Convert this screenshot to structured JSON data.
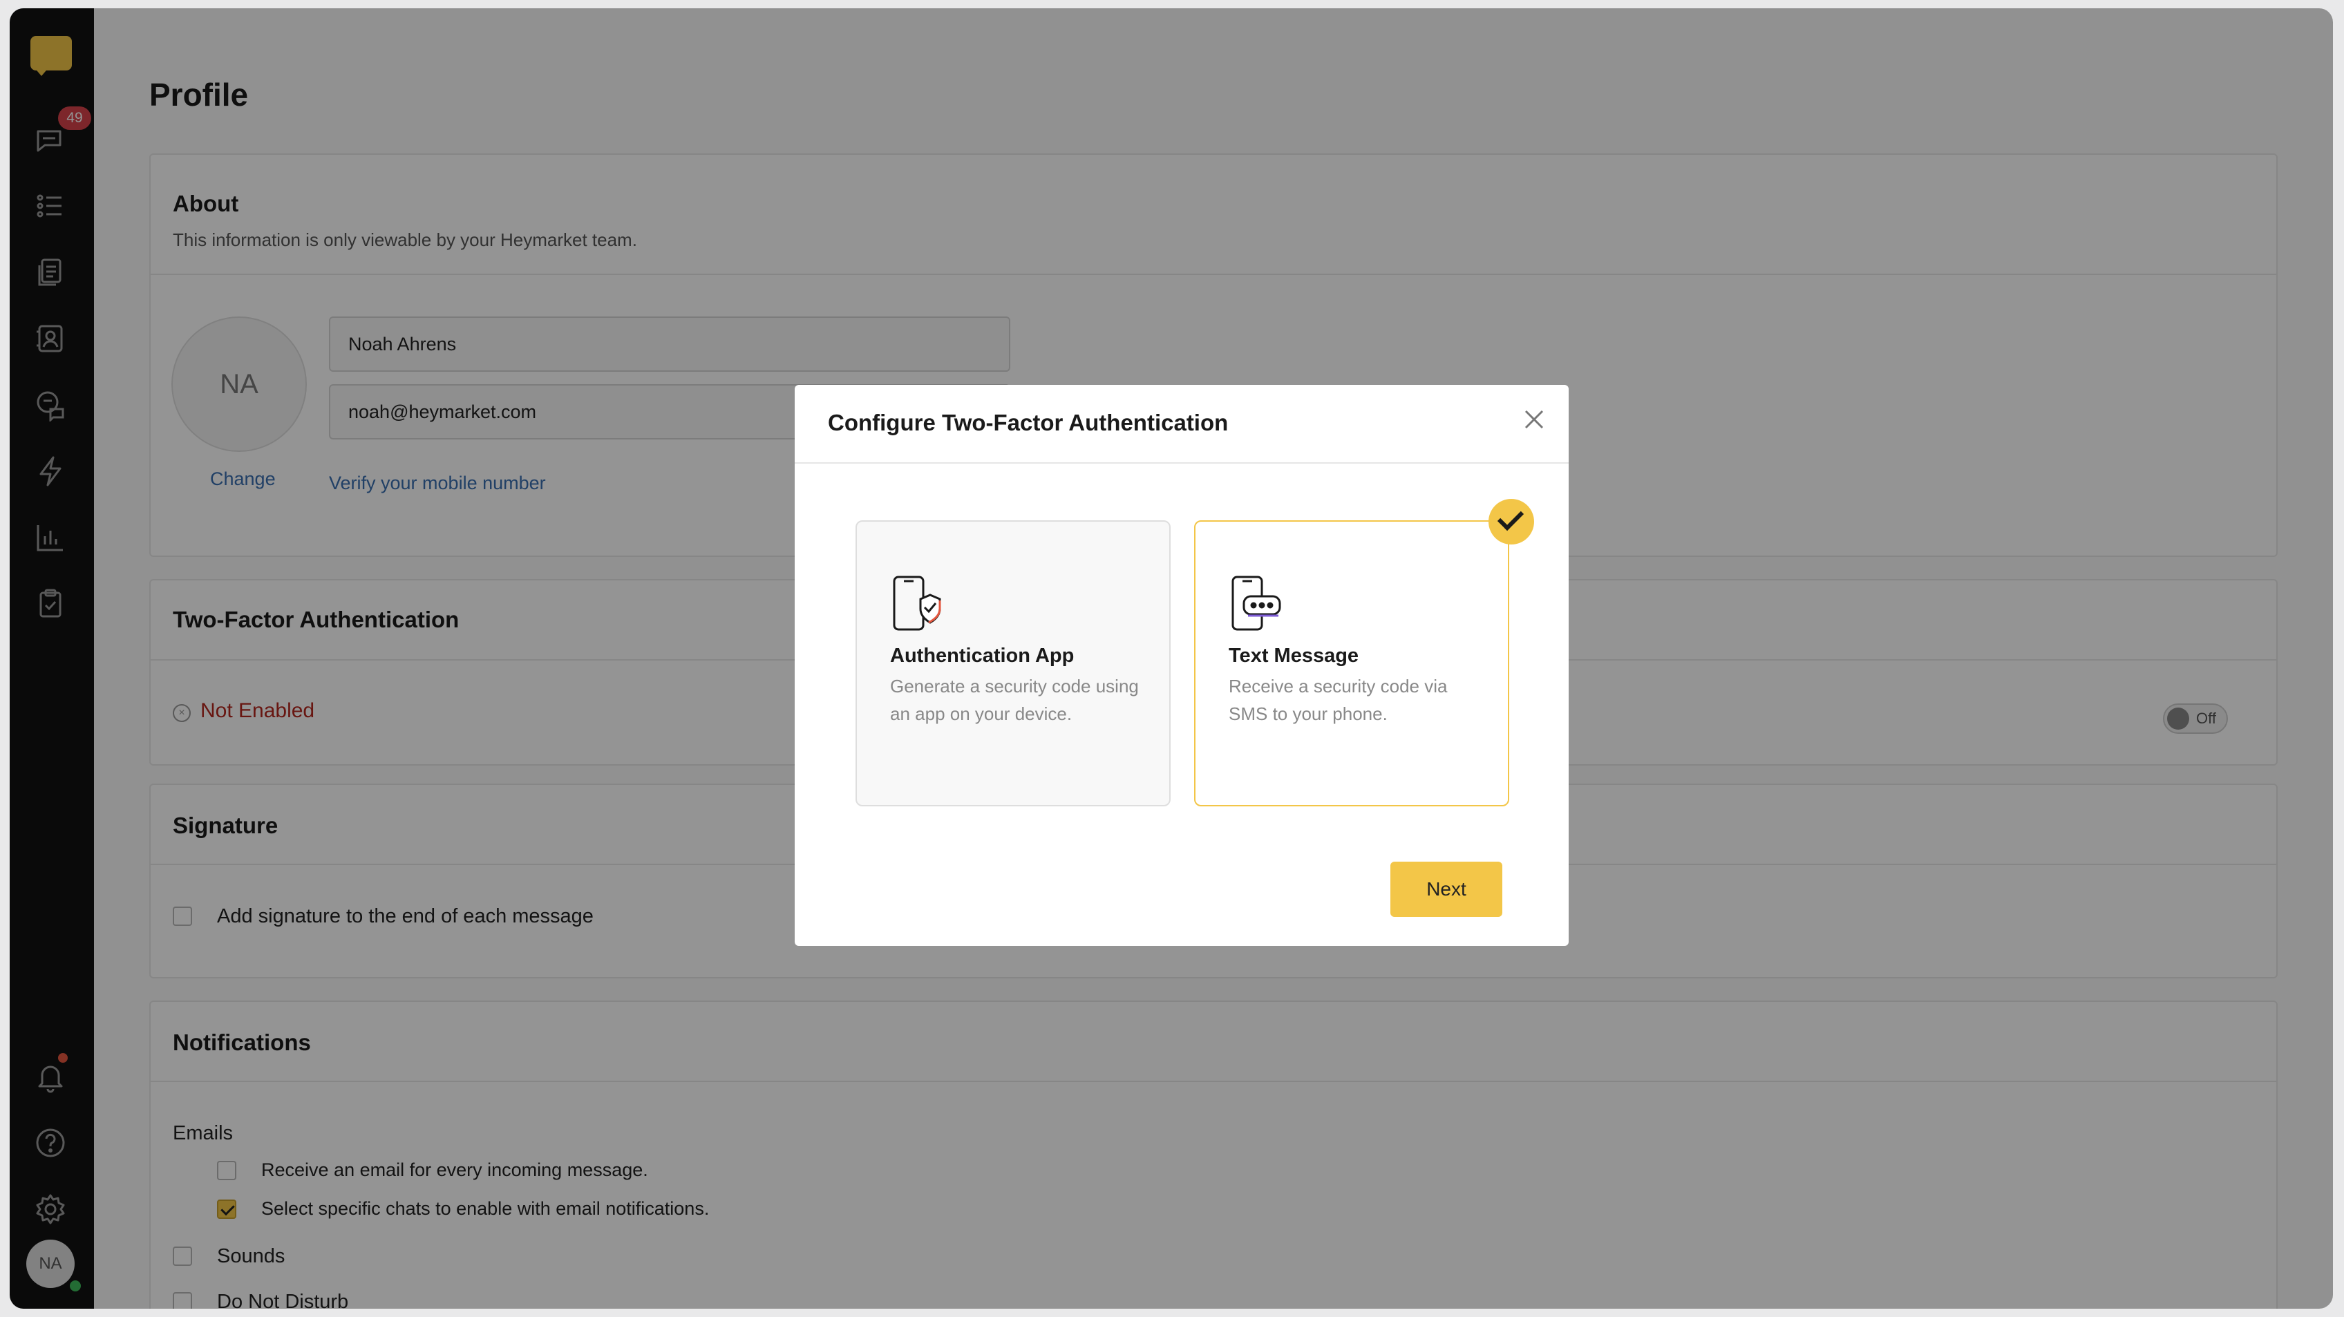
{
  "sidebar": {
    "unread_badge": "49",
    "nav_items": [
      {
        "name": "chats",
        "icon": "chat-bubble-icon"
      },
      {
        "name": "lists",
        "icon": "list-icon"
      },
      {
        "name": "templates",
        "icon": "documents-icon"
      },
      {
        "name": "contacts",
        "icon": "contact-card-icon"
      },
      {
        "name": "inbox",
        "icon": "inbox-chat-icon"
      },
      {
        "name": "automations",
        "icon": "lightning-icon"
      },
      {
        "name": "reports",
        "icon": "bar-chart-icon"
      },
      {
        "name": "tasks",
        "icon": "clipboard-check-icon"
      },
      {
        "name": "notifications",
        "icon": "bell-icon"
      },
      {
        "name": "help",
        "icon": "help-circle-icon"
      },
      {
        "name": "settings",
        "icon": "gear-icon"
      }
    ],
    "user_initials": "NA"
  },
  "page": {
    "title": "Profile"
  },
  "about": {
    "header": "About",
    "subtitle": "This information is only viewable by your Heymarket team.",
    "avatar_initials": "NA",
    "change_link": "Change",
    "name_value": "Noah Ahrens",
    "email_value": "noah@heymarket.com",
    "verify_link": "Verify your mobile number"
  },
  "two_factor": {
    "header": "Two-Factor Authentication",
    "status": "Not Enabled",
    "toggle_label": "Off"
  },
  "signature": {
    "header": "Signature",
    "checkbox_label": "Add signature to the end of each message",
    "checked": false
  },
  "notifications": {
    "header": "Notifications",
    "emails_label": "Emails",
    "email_every_label": "Receive an email for every incoming message.",
    "email_every_checked": false,
    "email_specific_label": "Select specific chats to enable with email notifications.",
    "email_specific_checked": true,
    "sounds_label": "Sounds",
    "dnd_label": "Do Not Disturb"
  },
  "modal": {
    "title": "Configure Two-Factor Authentication",
    "options": [
      {
        "title": "Authentication App",
        "description": "Generate a security code using an app on your device.",
        "icon": "phone-shield-icon",
        "selected": false
      },
      {
        "title": "Text Message",
        "description": "Receive a security code via SMS to your phone.",
        "icon": "phone-message-icon",
        "selected": true
      }
    ],
    "next_label": "Next"
  },
  "colors": {
    "accent": "#f3c648",
    "sidebar_bg": "#121212",
    "error": "#b3261e",
    "link": "#3a6fb0"
  }
}
